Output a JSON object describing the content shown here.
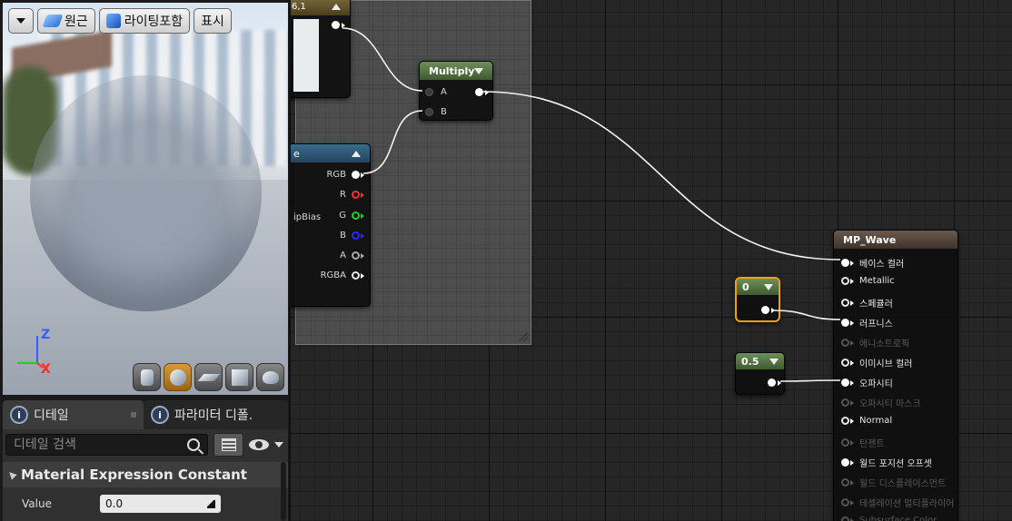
{
  "viewport": {
    "toolbar": {
      "perspective_label": "원근",
      "lighting_label": "라이팅포함",
      "show_label": "표시"
    },
    "axes": {
      "z": "Z",
      "x": "X"
    }
  },
  "panel_tabs": [
    {
      "label": "디테일"
    },
    {
      "label": "파라미터 디폴."
    }
  ],
  "details": {
    "search_placeholder": "디테일 검색",
    "category": "Material Expression Constant",
    "properties": [
      {
        "label": "Value",
        "value": "0.0"
      }
    ]
  },
  "graph": {
    "partial_node_title": "6,1",
    "multiply": {
      "title": "Multiply",
      "inputs": [
        "A",
        "B"
      ]
    },
    "texture_sample": {
      "title": "e",
      "outputs": [
        "RGB",
        "R",
        "G",
        "B",
        "A",
        "RGBA"
      ],
      "input_partial": "ipBias",
      "colors": {
        "R": "#ff2a2a",
        "G": "#22cc22",
        "B": "#2a2aff"
      }
    },
    "const_zero": {
      "value": "0"
    },
    "const_half": {
      "value": "0.5"
    },
    "material": {
      "title": "MP_Wave",
      "pins": [
        {
          "label": "베이스 컬러",
          "active": true,
          "connected": true
        },
        {
          "label": "Metallic",
          "active": true,
          "connected": false
        },
        {
          "label": "스페큘러",
          "active": true,
          "connected": false
        },
        {
          "label": "러프니스",
          "active": true,
          "connected": true
        },
        {
          "label": "애니소트로픽",
          "active": false,
          "connected": false
        },
        {
          "label": "이미시브 컬러",
          "active": true,
          "connected": false
        },
        {
          "label": "오파시티",
          "active": true,
          "connected": true
        },
        {
          "label": "오파시티 마스크",
          "active": false,
          "connected": false
        },
        {
          "label": "Normal",
          "active": true,
          "connected": false
        },
        {
          "label": "탄젠트",
          "active": false,
          "connected": false
        },
        {
          "label": "월드 포지션 오프셋",
          "active": true,
          "connected": true
        },
        {
          "label": "월드 디스플레이스먼트",
          "active": false,
          "connected": false
        },
        {
          "label": "테셀레이션 멀티플라이어",
          "active": false,
          "connected": false
        },
        {
          "label": "Subsurface Color",
          "active": false,
          "connected": false
        }
      ]
    }
  }
}
